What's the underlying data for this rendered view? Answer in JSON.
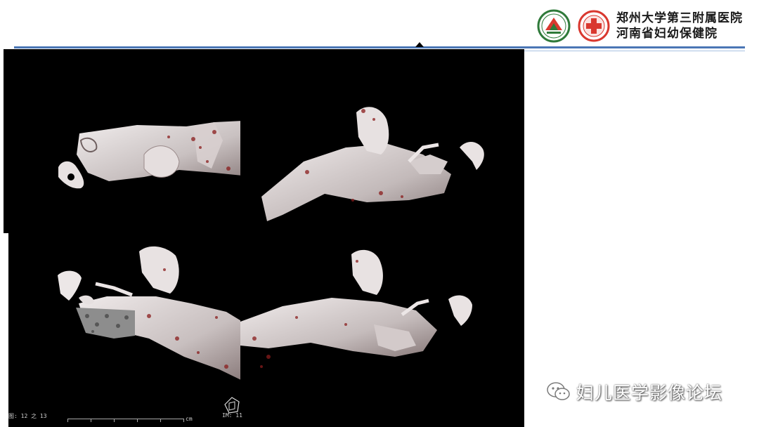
{
  "header": {
    "hospital_line1": "郑州大学第三附属医院",
    "hospital_line2": "河南省妇幼保健院",
    "logo1_icon": "zhengzhou-university-logo",
    "logo2_icon": "hospital-cross-logo",
    "accent_color": "#4a76b5"
  },
  "panels": [
    {
      "id": "top-left",
      "description_icon": "3d-ear-bone-render"
    },
    {
      "id": "top-right",
      "description_icon": "3d-ear-bone-render"
    },
    {
      "id": "bottom-left",
      "description_icon": "3d-ear-bone-render"
    },
    {
      "id": "bottom-right",
      "description_icon": "3d-ear-bone-render"
    }
  ],
  "overlay": {
    "image_index": "图: 12 之 13",
    "ruler_unit": "cm",
    "im_label": "IM: 11"
  },
  "watermark": {
    "text": "妇儿医学影像论坛",
    "icon": "wechat-icon"
  }
}
